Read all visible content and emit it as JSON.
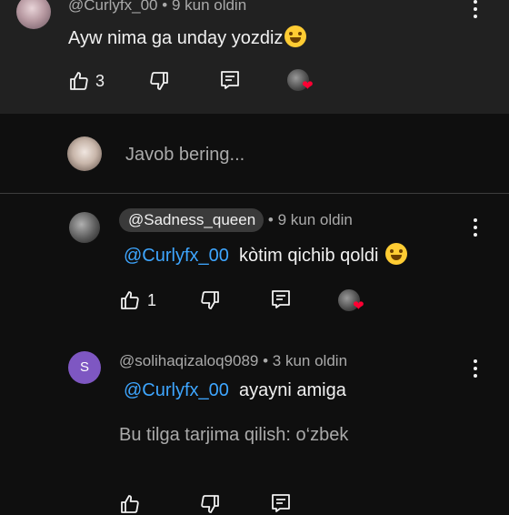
{
  "top_comment": {
    "author": "@Curlyfx_00",
    "time": "9 kun oldin",
    "text": "Ayw nima ga unday yozdiz",
    "emoji": "rofl-emoji",
    "likes": "3"
  },
  "reply_box": {
    "placeholder": "Javob bering..."
  },
  "replies": [
    {
      "author": "@Sadness_queen",
      "time": "9 kun oldin",
      "mention": "@Curlyfx_00",
      "text": "kòtim qichib qoldi",
      "emoji": "grinning-sweat-emoji",
      "likes": "1"
    },
    {
      "author": "@solihaqizaloq9089",
      "avatar_letter": "S",
      "avatar_color": "#7e57c2",
      "time": "3 kun oldin",
      "mention": "@Curlyfx_00",
      "text": "ayayni amiga",
      "translate": "Bu tilga tarjima qilish: o‘zbek"
    }
  ],
  "separator": "•",
  "colors": {
    "mention": "#3ea6ff",
    "heart": "#ff0033",
    "background": "#0f0f0f",
    "top_background": "#212121"
  }
}
